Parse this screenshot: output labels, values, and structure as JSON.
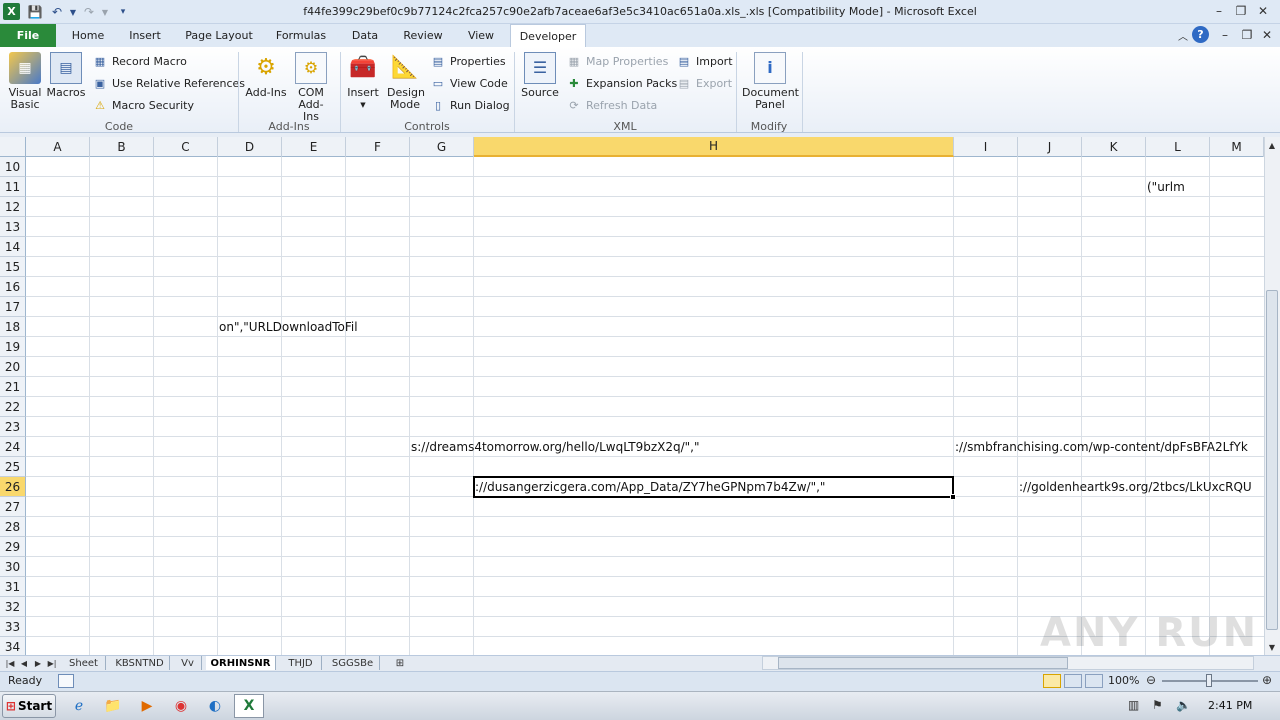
{
  "window": {
    "title": "f44fe399c29bef0c9b77124c2fca257c90e2afb7aceae6af3e5c3410ac651a0a.xls_.xls  [Compatibility Mode] - Microsoft Excel"
  },
  "qat": {
    "save_icon": "save-icon",
    "undo_icon": "undo-icon",
    "redo_icon": "redo-icon"
  },
  "ribbon": {
    "tabs": [
      "File",
      "Home",
      "Insert",
      "Page Layout",
      "Formulas",
      "Data",
      "Review",
      "View",
      "Developer"
    ],
    "active_tab": "Developer",
    "code": {
      "label": "Code",
      "visual_basic": "Visual Basic",
      "macros": "Macros",
      "record_macro": "Record Macro",
      "use_relative": "Use Relative References",
      "macro_security": "Macro Security"
    },
    "addins": {
      "label": "Add-Ins",
      "addins": "Add-Ins",
      "com_addins": "COM Add-Ins"
    },
    "controls": {
      "label": "Controls",
      "insert": "Insert",
      "design_mode": "Design Mode",
      "properties": "Properties",
      "view_code": "View Code",
      "run_dialog": "Run Dialog"
    },
    "xml": {
      "label": "XML",
      "source": "Source",
      "map_properties": "Map Properties",
      "expansion_packs": "Expansion Packs",
      "refresh_data": "Refresh Data",
      "import": "Import",
      "export": "Export"
    },
    "modify": {
      "label": "Modify",
      "document_panel": "Document Panel"
    }
  },
  "grid": {
    "columns": [
      "A",
      "B",
      "C",
      "D",
      "E",
      "F",
      "G",
      "H",
      "I",
      "J",
      "K",
      "L",
      "M"
    ],
    "selected_column": "H",
    "rows": [
      "10",
      "11",
      "12",
      "13",
      "14",
      "15",
      "16",
      "17",
      "18",
      "19",
      "20",
      "21",
      "22",
      "23",
      "24",
      "25",
      "26",
      "27",
      "28",
      "29",
      "30",
      "31",
      "32",
      "33",
      "34"
    ],
    "cells": {
      "L11": "(\"urlm",
      "D18": "on\",\"URLDownloadToFil",
      "G24": "s://dreams4tomorrow.org/hello/LwqLT9bzX2q/\",\"",
      "I24": "://smbfranchising.com/wp-content/dpFsBFA2LfYk",
      "H26": "://dusangerzicgera.com/App_Data/ZY7heGPNpm7b4Zw/\",\"",
      "J26": "://goldenheartk9s.org/2tbcs/LkUxcRQU"
    }
  },
  "sheets": {
    "tabs": [
      "Sheet",
      "KBSNTND",
      "Vv",
      "ORHINSNR",
      "THJD",
      "SGGSBe"
    ],
    "active": "ORHINSNR"
  },
  "status": {
    "mode": "Ready",
    "zoom": "100%"
  },
  "taskbar": {
    "start": "Start",
    "time": "2:41 PM"
  },
  "watermark": "ANY RUN"
}
